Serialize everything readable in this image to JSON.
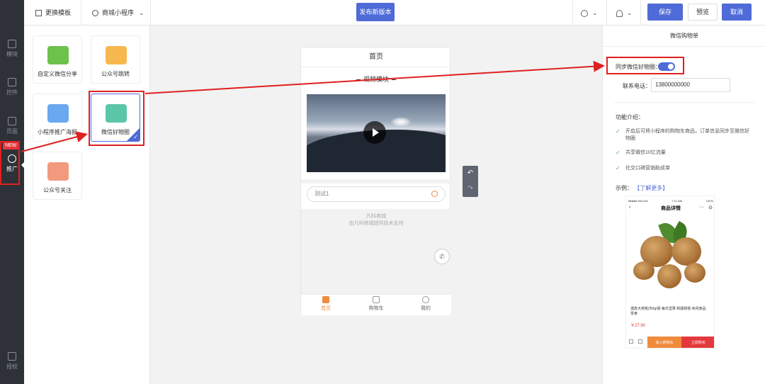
{
  "nav": {
    "items": [
      {
        "label": "模块",
        "icon": "module-icon"
      },
      {
        "label": "控件",
        "icon": "widget-icon"
      },
      {
        "label": "页面",
        "icon": "page-icon"
      },
      {
        "label": "推广",
        "icon": "promote-icon"
      },
      {
        "label": "授权",
        "icon": "shield-icon"
      }
    ],
    "new_badge": "NEW"
  },
  "topbar": {
    "template_label": "更换模板",
    "mall_label": "商城小程序",
    "publish_label": "发布新版本",
    "save_label": "保存",
    "preview_label": "预览",
    "cancel_label": "取消"
  },
  "widgets": [
    {
      "label": "自定义微信分享"
    },
    {
      "label": "公众号跳转"
    },
    {
      "label": "小程序推广海报"
    },
    {
      "label": "微信好物圈"
    },
    {
      "label": "公众号关注"
    }
  ],
  "phone": {
    "title": "首页",
    "video_label": "视频模块",
    "search_placeholder": "测试1",
    "brand_line1": "凡科商城",
    "brand_line2": "由凡科商城提供技术支持",
    "tabs": [
      {
        "label": "首页"
      },
      {
        "label": "购物车"
      },
      {
        "label": "我的"
      }
    ]
  },
  "right_panel": {
    "title": "微信购物单",
    "sync_label": "同步微信好物圈：",
    "sync_enabled": true,
    "phone_label": "联系电话：",
    "phone_value": "13800000000",
    "intro_label": "功能介绍：",
    "features": [
      "开启后可将小程序的购物车商品，订单信息同步至微信好物圈",
      "共享微信10亿流量",
      "社交口碑营销助成单"
    ],
    "example_label": "示例：",
    "example_link": "【了解更多】",
    "example": {
      "status_left": "●●●●● WeChat",
      "status_mid": "7:21 AM",
      "status_right": "100%",
      "header": "商品详情",
      "product_name": "澳皮大核桃250g/袋 每日坚果 新疆核桃 休闲食品 零食",
      "price": "￥27.90",
      "add_cart": "加入购物车",
      "buy_now": "立即购买"
    }
  },
  "colors": {
    "accent": "#4f6bd8",
    "nav_bg": "#2e3238",
    "annotation": "#e02020",
    "orange": "#f08a3c"
  }
}
